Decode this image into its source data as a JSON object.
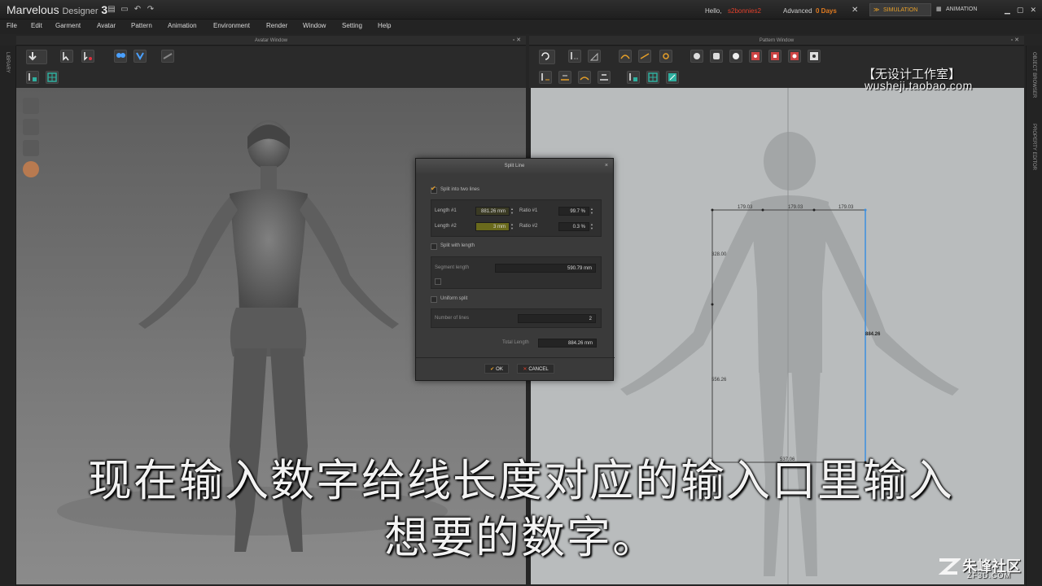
{
  "app": {
    "title": "Marvelous",
    "title_sub": "Designer",
    "version": "3",
    "hello_label": "Hello,",
    "username": "s2bonnies2",
    "license_label": "Advanced",
    "days_left": "0 Days",
    "modes": [
      "SIMULATION",
      "ANIMATION"
    ],
    "active_mode": "SIMULATION",
    "colors": {
      "accent": "#e8a028",
      "username": "#e0402c",
      "pattern_line": "#3a8fe0"
    }
  },
  "menu": [
    "File",
    "Edit",
    "Garment",
    "Avatar",
    "Pattern",
    "Animation",
    "Environment",
    "Render",
    "Window",
    "Setting",
    "Help"
  ],
  "windows": {
    "avatar": "Avatar Window",
    "pattern": "Pattern Window",
    "library_tab": "LIBRARY",
    "object_browser_tab": "OBJECT BROWSER",
    "property_editor_tab": "PROPERTY EDITOR"
  },
  "watermark": {
    "top_cn": "【无设计工作室】",
    "top_url": "wusheji.taobao.com",
    "bottom_cn": "朱峰社区",
    "bottom_url": "ZF3D.COM"
  },
  "pattern_measurements": {
    "top_segments": [
      "179.03",
      "179.03",
      "179.03"
    ],
    "left_upper": "328.00",
    "left_lower": "556.26",
    "bottom": "537.06",
    "right": "884.26"
  },
  "dialog": {
    "title": "Split Line",
    "split_two_lines": {
      "label": "Split into two lines",
      "checked": true
    },
    "length1": {
      "label": "Length #1",
      "value": "881.26 mm"
    },
    "length2": {
      "label": "Length #2",
      "value": "3 mm"
    },
    "ratio1": {
      "label": "Ratio #1",
      "value": "99.7 %"
    },
    "ratio2": {
      "label": "Ratio #2",
      "value": "0.3 %"
    },
    "split_with_length": {
      "label": "Split with length",
      "checked": false
    },
    "segment_length": {
      "label": "Segment length",
      "value": "590.79 mm"
    },
    "uniform_split": {
      "label": "Uniform split",
      "checked": false
    },
    "number_of_lines": {
      "label": "Number of lines",
      "value": "2"
    },
    "total_length": {
      "label": "Total Length",
      "value": "884.26 mm"
    },
    "ok_label": "OK",
    "cancel_label": "CANCEL"
  },
  "subtitles": {
    "line1": "现在输入数字给线长度对应的输入口里输入",
    "line2": "想要的数字。"
  }
}
